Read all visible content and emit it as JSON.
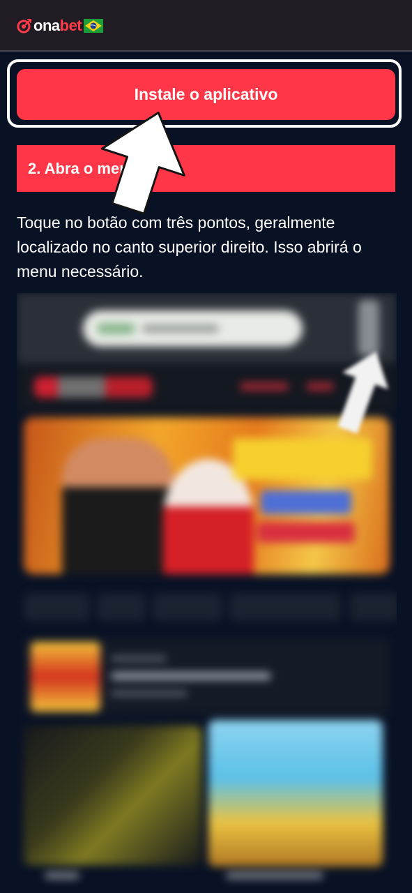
{
  "header": {
    "logo_text_ona": "ona",
    "logo_text_bet": "bet",
    "flag": "brazil-flag"
  },
  "install": {
    "label": "Instale o aplicativo"
  },
  "step": {
    "heading": "2. Abra o menu",
    "description": "Toque no botão com três pontos, geralmente localizado no canto superior direito. Isso abrirá o menu necessário."
  },
  "colors": {
    "background": "#091225",
    "header_bg": "#211b23",
    "accent_red": "#fe3647",
    "text": "#ffffff"
  },
  "icons": {
    "pointer": "arrow-up-icon",
    "logo": "onabet-logo-icon"
  }
}
